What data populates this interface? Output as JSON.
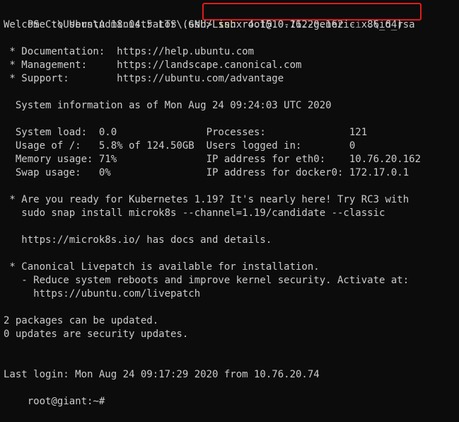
{
  "colors": {
    "background": "#0c0c0c",
    "text": "#cccccc",
    "command": "#f9f1a5",
    "option": "#9a9a9a",
    "highlight_border": "#e11b1b"
  },
  "prompt": {
    "path": "PS C:\\Users\\Administrator\\.ssh> ",
    "command": "ssh",
    "target": " root@10.76.20.162 ",
    "option": "-i",
    "arg": " .\\id_rsa"
  },
  "welcome": "Welcome to Ubuntu 18.04.5 LTS (GNU/Linux 4.15.0-112-generic x86_64)",
  "links": [
    {
      "label": " * Documentation:  ",
      "url": "https://help.ubuntu.com"
    },
    {
      "label": " * Management:     ",
      "url": "https://landscape.canonical.com"
    },
    {
      "label": " * Support:        ",
      "url": "https://ubuntu.com/advantage"
    }
  ],
  "sysinfo_heading": "  System information as of Mon Aug 24 09:24:03 UTC 2020",
  "sysinfo": [
    {
      "left": "  System load:  0.0               ",
      "right": "Processes:              121"
    },
    {
      "left": "  Usage of /:   5.8% of 124.50GB  ",
      "right": "Users logged in:        0"
    },
    {
      "left": "  Memory usage: 71%               ",
      "right": "IP address for eth0:    10.76.20.162"
    },
    {
      "left": "  Swap usage:   0%                ",
      "right": "IP address for docker0: 172.17.0.1"
    }
  ],
  "kubernetes": [
    " * Are you ready for Kubernetes 1.19? It's nearly here! Try RC3 with",
    "   sudo snap install microk8s --channel=1.19/candidate --classic",
    "",
    "   https://microk8s.io/ has docs and details."
  ],
  "livepatch": [
    " * Canonical Livepatch is available for installation.",
    "   - Reduce system reboots and improve kernel security. Activate at:",
    "     https://ubuntu.com/livepatch"
  ],
  "updates": [
    "2 packages can be updated.",
    "0 updates are security updates."
  ],
  "last_login": "Last login: Mon Aug 24 09:17:29 2020 from 10.76.20.74",
  "shell_prompt": "root@giant:~# "
}
